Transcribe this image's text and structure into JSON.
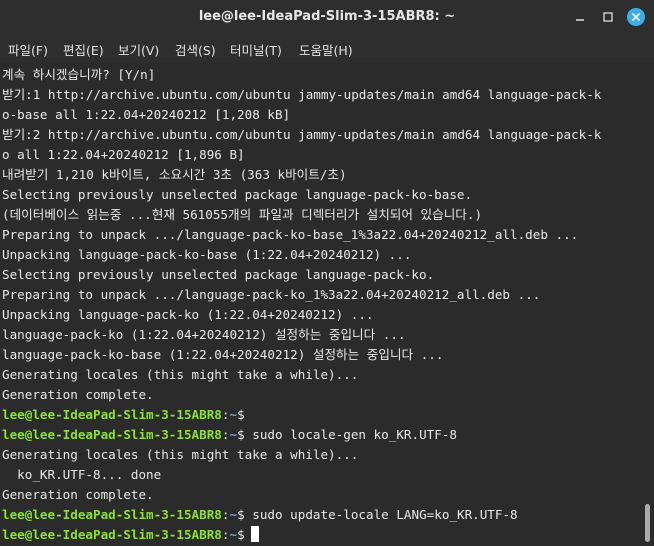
{
  "window": {
    "title": "lee@lee-IdeaPad-Slim-3-15ABR8: ~"
  },
  "menu": [
    {
      "label": "파일(F)",
      "name": "menu-file"
    },
    {
      "label": "편집(E)",
      "name": "menu-edit"
    },
    {
      "label": "보기(V)",
      "name": "menu-view"
    },
    {
      "label": "검색(S)",
      "name": "menu-search"
    },
    {
      "label": "터미널(T)",
      "name": "menu-terminal"
    },
    {
      "label": "도움말(H)",
      "name": "menu-help"
    }
  ],
  "terminal": {
    "lines": [
      "계속 하시겠습니까? [Y/n]",
      "받기:1 http://archive.ubuntu.com/ubuntu jammy-updates/main amd64 language-pack-k",
      "o-base all 1:22.04+20240212 [1,208 kB]",
      "받기:2 http://archive.ubuntu.com/ubuntu jammy-updates/main amd64 language-pack-k",
      "o all 1:22.04+20240212 [1,896 B]",
      "내려받기 1,210 k바이트, 소요시간 3초 (363 k바이트/초)",
      "Selecting previously unselected package language-pack-ko-base.",
      "(데이터베이스 읽는중 ...현재 561055개의 파일과 디렉터리가 설치되어 있습니다.)",
      "Preparing to unpack .../language-pack-ko-base_1%3a22.04+20240212_all.deb ...",
      "Unpacking language-pack-ko-base (1:22.04+20240212) ...",
      "Selecting previously unselected package language-pack-ko.",
      "Preparing to unpack .../language-pack-ko_1%3a22.04+20240212_all.deb ...",
      "Unpacking language-pack-ko (1:22.04+20240212) ...",
      "language-pack-ko (1:22.04+20240212) 설정하는 중입니다 ...",
      "language-pack-ko-base (1:22.04+20240212) 설정하는 중입니다 ...",
      "Generating locales (this might take a while)...",
      "Generation complete."
    ],
    "prompt_user": "lee@lee-IdeaPad-Slim-3-15ABR8",
    "prompt_sep": ":",
    "prompt_path": "~",
    "prompt_symbol": "$",
    "commands": [
      "",
      "sudo locale-gen ko_KR.UTF-8",
      "sudo update-locale LANG=ko_KR.UTF-8",
      ""
    ],
    "output_after_cmd2": [
      "Generating locales (this might take a while)...",
      "  ko_KR.UTF-8... done",
      "Generation complete."
    ]
  },
  "colors": {
    "background": "#2b2b2b",
    "prompt_user": "#8ae234",
    "prompt_path": "#729fcf",
    "close_button": "#3daee9"
  },
  "icons": [
    "minimize-icon",
    "maximize-icon",
    "close-icon"
  ]
}
